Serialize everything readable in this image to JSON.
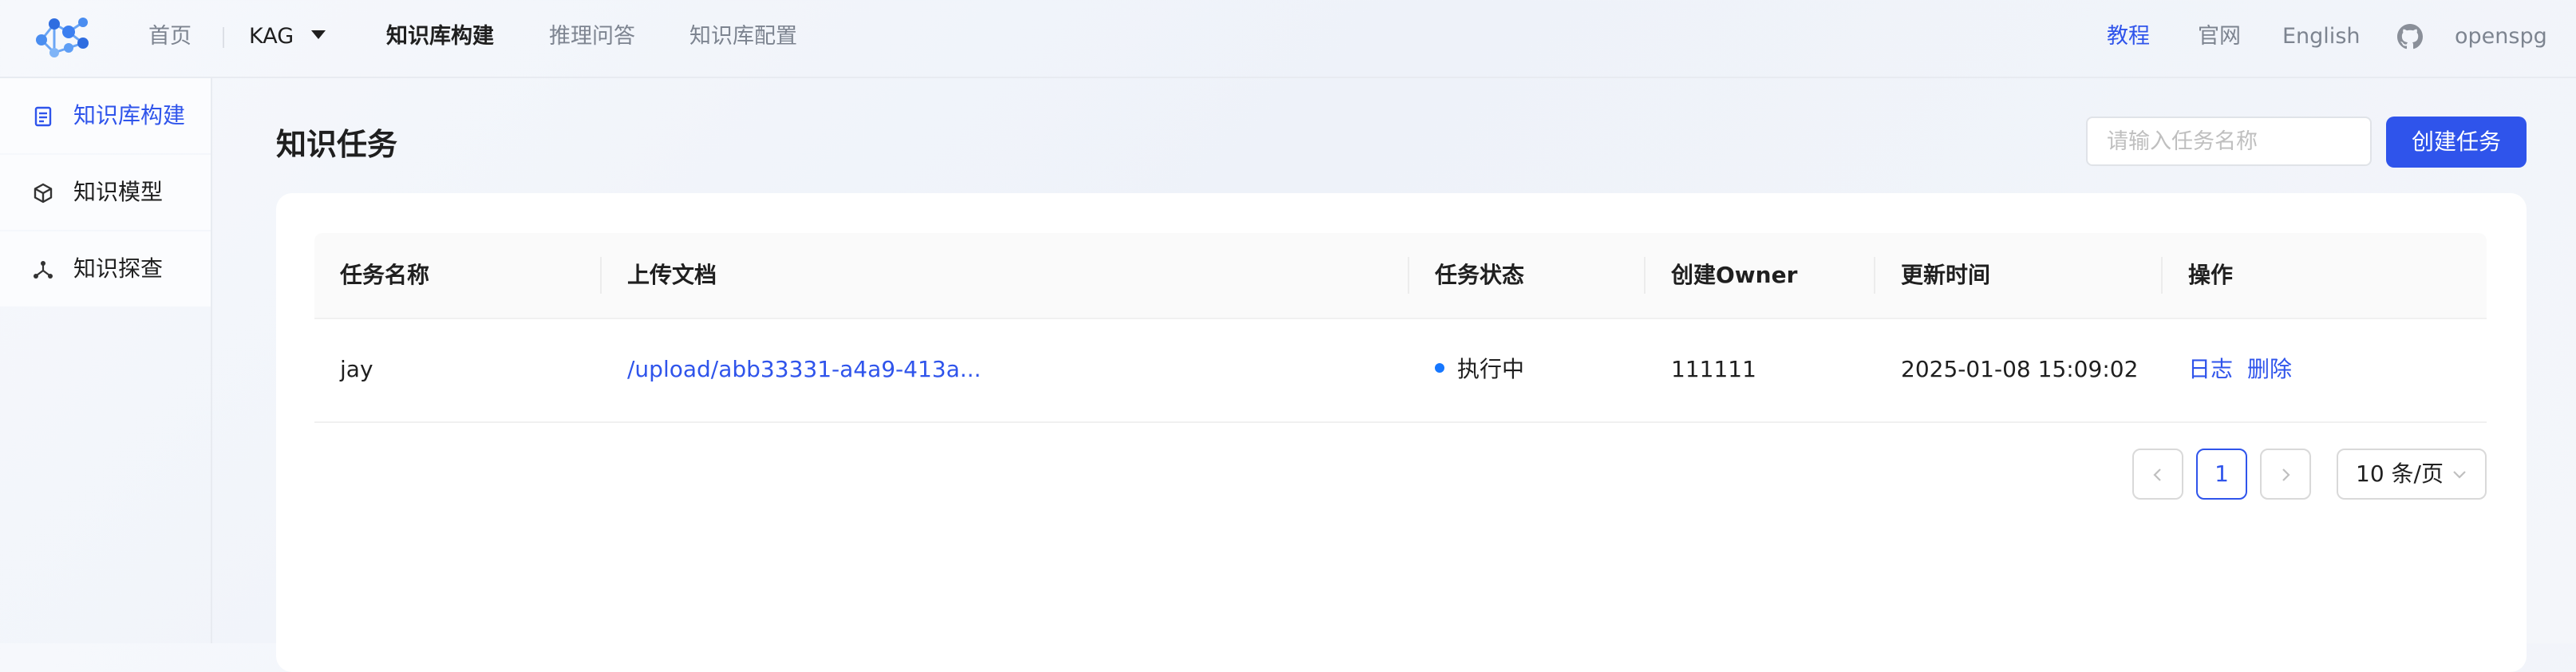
{
  "nav": {
    "home": "首页",
    "project": "KAG",
    "build": "知识库构建",
    "qa": "推理问答",
    "config": "知识库配置",
    "tutorial": "教程",
    "website": "官网",
    "language": "English",
    "user": "openspg"
  },
  "sidebar": {
    "items": [
      {
        "label": "知识库构建",
        "icon": "document-icon",
        "active": true
      },
      {
        "label": "知识模型",
        "icon": "cube-icon",
        "active": false
      },
      {
        "label": "知识探查",
        "icon": "nodes-icon",
        "active": false
      }
    ]
  },
  "main": {
    "title": "知识任务",
    "search_placeholder": "请输入任务名称",
    "create_button": "创建任务"
  },
  "table": {
    "columns": [
      "任务名称",
      "上传文档",
      "任务状态",
      "创建Owner",
      "更新时间",
      "操作"
    ],
    "rows": [
      {
        "name": "jay",
        "document": "/upload/abb33331-a4a9-413a...",
        "status": "执行中",
        "owner": "111111",
        "updated": "2025-01-08 15:09:02",
        "action_log": "日志",
        "action_delete": "删除"
      }
    ]
  },
  "pagination": {
    "current_page": "1",
    "page_size": "10 条/页"
  },
  "colors": {
    "accent": "#2f54eb",
    "status_running": "#1677ff"
  }
}
